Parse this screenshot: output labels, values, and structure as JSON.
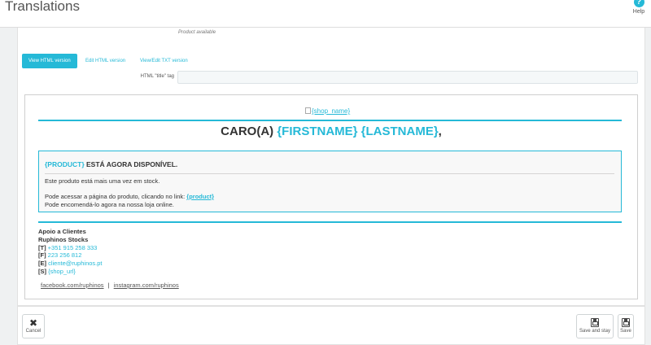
{
  "header": {
    "title": "Translations",
    "help_label": "Help",
    "help_glyph": "?"
  },
  "form": {
    "hint_text": "Product available",
    "tabs": [
      {
        "label": "View HTML version",
        "active": true
      },
      {
        "label": "Edit HTML version",
        "active": false
      },
      {
        "label": "View/Edit TXT version",
        "active": false
      }
    ],
    "title_tag_label": "HTML \"title\" tag",
    "title_tag_value": ""
  },
  "email": {
    "shop_image_alt": "{shop_name}",
    "greeting_prefix": "CARO(A) ",
    "greeting_firstname": "{FIRSTNAME}",
    "greeting_space": " ",
    "greeting_lastname": "{LASTNAME}",
    "greeting_suffix": ",",
    "box_product_placeholder": "{PRODUCT}",
    "box_heading_rest": " ESTÁ AGORA DISPONÍVEL.",
    "line1": "Este produto está mais uma vez em stock.",
    "line2_text": "Pode acessar a página do produto, clicando no link: ",
    "line2_link": "{product}",
    "line3": "Pode encomendá-lo agora na nossa loja online.",
    "signature": {
      "title": "Apoio a Clientes",
      "company": "Ruphinos Stocks",
      "phone_prefix": "[T] ",
      "phone": "+351 915 258 333",
      "fax_prefix": "[F] ",
      "fax": "223 256 812",
      "email_prefix": "[E] ",
      "email": "cliente@ruphinos.pt",
      "site_prefix": "[S] ",
      "site": "{shop_url}"
    },
    "social_facebook": "facebook.com/ruphinos",
    "social_separator": "|",
    "social_instagram": "instagram.com/ruphinos"
  },
  "footer": {
    "cancel_label": "Cancel",
    "cancel_glyph": "✖",
    "save_stay_label": "Save and stay",
    "save_label": "Save"
  },
  "colors": {
    "accent": "#25b9d7",
    "text": "#333333",
    "background": "#eff1f2"
  }
}
